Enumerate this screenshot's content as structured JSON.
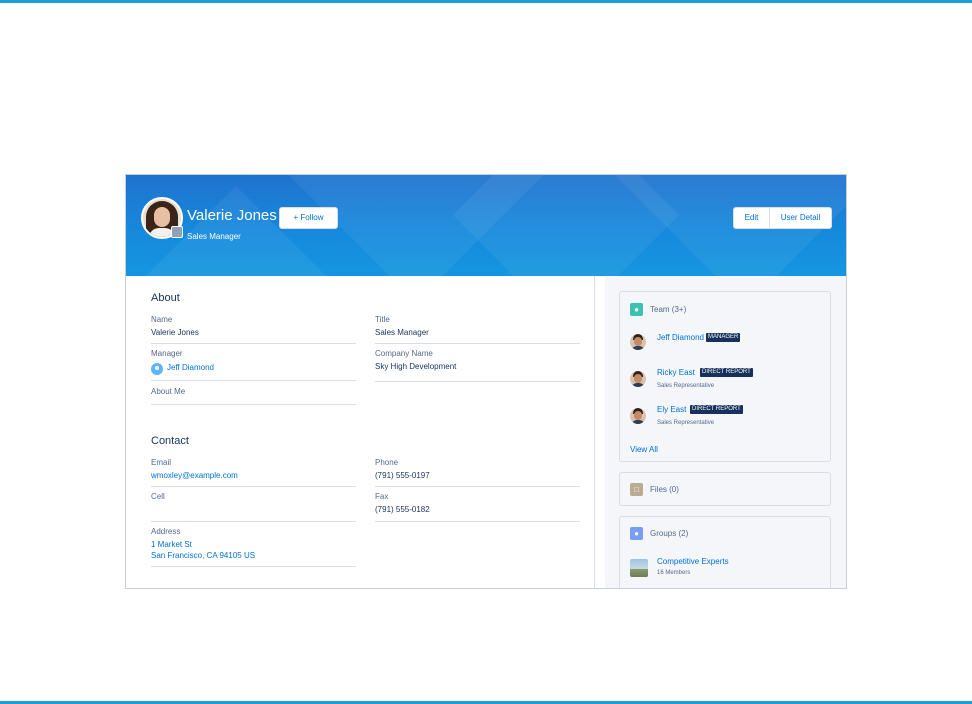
{
  "header": {
    "name": "Valerie Jones",
    "title": "Sales Manager",
    "follow_label": "+ Follow",
    "edit_label": "Edit",
    "user_detail_label": "User Detail"
  },
  "about": {
    "heading": "About",
    "name_label": "Name",
    "name_value": "Valerie Jones",
    "title_label": "Title",
    "title_value": "Sales Manager",
    "manager_label": "Manager",
    "manager_value": "Jeff Diamond",
    "company_label": "Company Name",
    "company_value": "Sky High Development",
    "about_me_label": "About Me"
  },
  "contact": {
    "heading": "Contact",
    "email_label": "Email",
    "email_value": "wmoxley@example.com",
    "phone_label": "Phone",
    "phone_value": "(791) 555-0197",
    "cell_label": "Cell",
    "fax_label": "Fax",
    "fax_value": "(791) 555-0182",
    "address_label": "Address",
    "address_line1": "1 Market St",
    "address_line2": "San Francisco, CA 94105 US"
  },
  "team": {
    "title": "Team (3+)",
    "members": [
      {
        "name": "Jeff Diamond",
        "tag": "MANAGER",
        "role": ""
      },
      {
        "name": "Ricky East",
        "tag": "DIRECT REPORT",
        "role": "Sales Representative"
      },
      {
        "name": "Ely East",
        "tag": "DIRECT REPORT",
        "role": "Sales Representative"
      }
    ],
    "view_all": "View All"
  },
  "files": {
    "title": "Files (0)"
  },
  "groups": {
    "title": "Groups (2)",
    "items": [
      {
        "name": "Competitive Experts",
        "members": "16 Members"
      }
    ]
  },
  "colors": {
    "banner": "#1689dc",
    "link": "#0070d2",
    "team_icon": "#3cc2b3",
    "files_icon": "#baac93",
    "groups_icon": "#779ef2",
    "badge_bg": "#16325c"
  },
  "icons": [
    "person-icon",
    "file-icon",
    "group-icon",
    "plus-icon",
    "user-badge-icon"
  ]
}
